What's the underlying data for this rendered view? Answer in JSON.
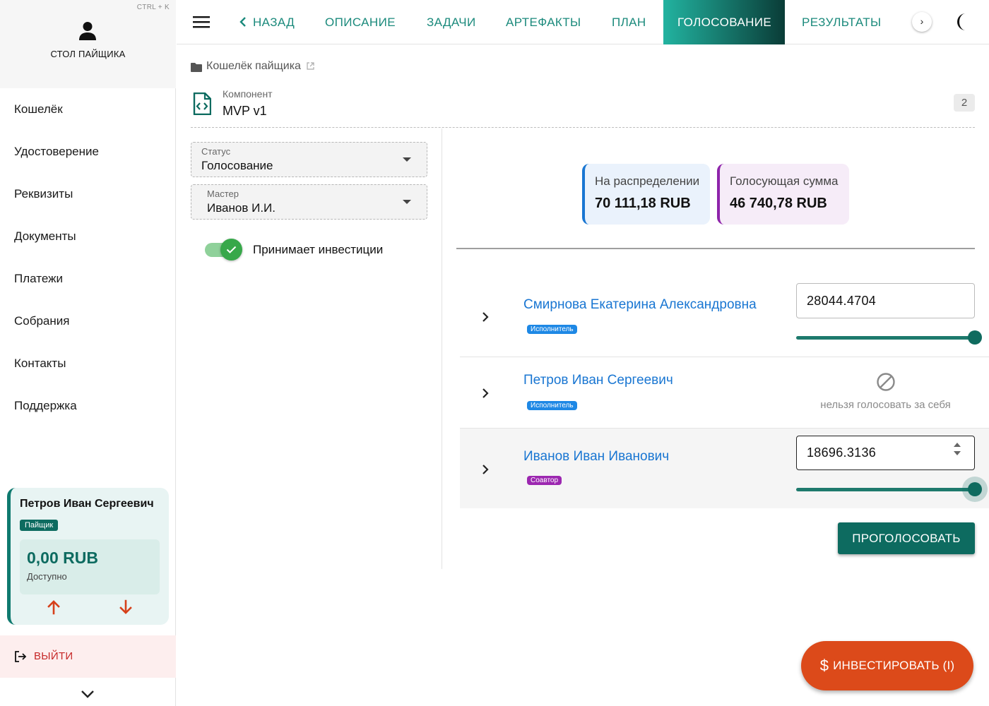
{
  "sidebar": {
    "hotkey": "CTRL + K",
    "title": "СТОЛ ПАЙЩИКА",
    "items": [
      {
        "label": "Кошелёк"
      },
      {
        "label": "Удостоверение"
      },
      {
        "label": "Реквизиты"
      },
      {
        "label": "Документы"
      },
      {
        "label": "Платежи"
      },
      {
        "label": "Собрания"
      },
      {
        "label": "Контакты"
      },
      {
        "label": "Поддержка"
      }
    ],
    "wallet": {
      "name": "Петров Иван Сергеевич",
      "role": "Пайщик",
      "amount": "0,00 RUB",
      "amount_label": "Доступно"
    },
    "logout_label": "ВЫЙТИ"
  },
  "topbar": {
    "tabs": {
      "back": "НАЗАД",
      "description": "ОПИСАНИЕ",
      "tasks": "ЗАДАЧИ",
      "artifacts": "АРТЕФАКТЫ",
      "plan": "ПЛАН",
      "voting": "ГОЛОСОВАНИЕ",
      "results": "РЕЗУЛЬТАТЫ"
    },
    "active_tab": "voting",
    "scroll_glyph": "›"
  },
  "breadcrumb": {
    "text": "Кошелёк пайщика"
  },
  "component": {
    "label": "Компонент",
    "title": "MVP v1",
    "count": "2"
  },
  "form": {
    "status": {
      "label": "Статус",
      "value": "Голосование"
    },
    "master": {
      "label": "Мастер",
      "value": "Иванов И.И."
    },
    "accepts_investments": {
      "label": "Принимает инвестиции",
      "checked": true
    }
  },
  "stats": {
    "distribution": {
      "label": "На распределении",
      "value": "70 111,18 RUB",
      "color": "#1976d2"
    },
    "voting_sum": {
      "label": "Голосующая сумма",
      "value": "46 740,78 RUB",
      "color": "#8e24aa"
    }
  },
  "votes": [
    {
      "name": "Смирнова Екатерина Александровна",
      "role": "Исполнитель",
      "value": "28044.4704",
      "slider_fraction": 1.0
    },
    {
      "name": "Петров Иван Сергеевич",
      "role": "Исполнитель",
      "disabled_text": "нельзя голосовать за себя"
    },
    {
      "name": "Иванов Иван Иванович",
      "role": "Соавтор",
      "value": "18696.3136",
      "slider_fraction": 1.0
    }
  ],
  "actions": {
    "vote_label": "ПРОГОЛОСОВАТЬ",
    "invest_label": "ИНВЕСТИРОВАТЬ (I)",
    "invest_icon": "$"
  },
  "colors": {
    "brand": "#0d6b60",
    "link": "#1976d2",
    "invest": "#dc4a1a"
  }
}
